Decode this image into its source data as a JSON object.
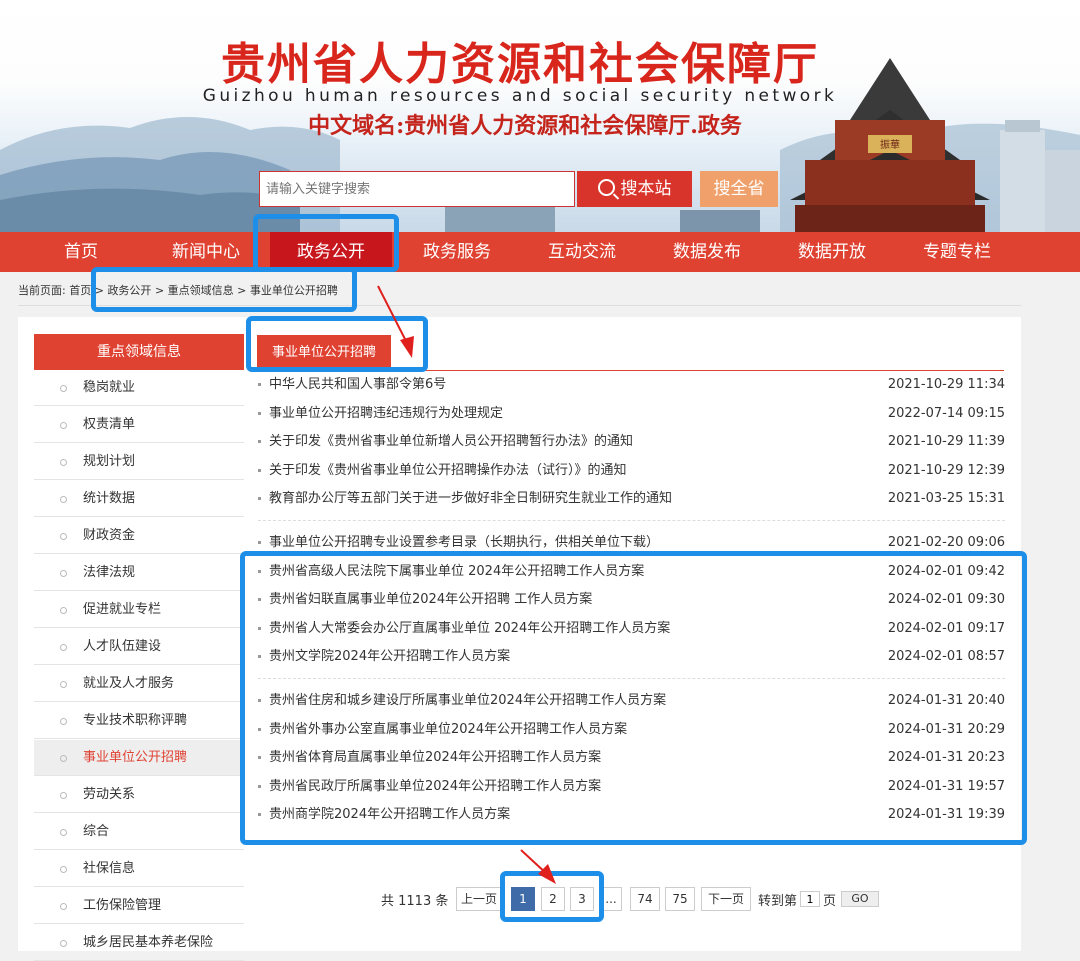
{
  "header": {
    "title": "贵州省人力资源和社会保障厅",
    "subtitle": "Guizhou human resources and social security network",
    "domain_name": "中文域名:贵州省人力资源和社会保障厅.政务",
    "tower_sign": "振華"
  },
  "search": {
    "placeholder": "请输入关键字搜索",
    "search_site_label": "搜本站",
    "search_all_label": "搜全省"
  },
  "nav": {
    "items": [
      "首页",
      "新闻中心",
      "政务公开",
      "政务服务",
      "互动交流",
      "数据发布",
      "数据开放",
      "专题专栏"
    ],
    "active_index": 2
  },
  "breadcrumb": {
    "prefix": "当前页面:",
    "items": [
      "首页",
      "政务公开",
      "重点领域信息",
      "事业单位公开招聘"
    ],
    "separator": ">"
  },
  "sidebar": {
    "heading": "重点领域信息",
    "items": [
      "稳岗就业",
      "权责清单",
      "规划计划",
      "统计数据",
      "财政资金",
      "法律法规",
      "促进就业专栏",
      "人才队伍建设",
      "就业及人才服务",
      "专业技术职称评聘",
      "事业单位公开招聘",
      "劳动关系",
      "综合",
      "社保信息",
      "工伤保险管理",
      "城乡居民基本养老保险"
    ],
    "active_index": 10
  },
  "content": {
    "tab_label": "事业单位公开招聘",
    "groups": [
      [
        {
          "title": "中华人民共和国人事部令第6号",
          "date": "2021-10-29 11:34"
        },
        {
          "title": "事业单位公开招聘违纪违规行为处理规定",
          "date": "2022-07-14 09:15"
        },
        {
          "title": "关于印发《贵州省事业单位新增人员公开招聘暂行办法》的通知",
          "date": "2021-10-29 11:39"
        },
        {
          "title": "关于印发《贵州省事业单位公开招聘操作办法（试行）》的通知",
          "date": "2021-10-29 12:39"
        },
        {
          "title": "教育部办公厅等五部门关于进一步做好非全日制研究生就业工作的通知",
          "date": "2021-03-25 15:31"
        }
      ],
      [
        {
          "title": "事业单位公开招聘专业设置参考目录（长期执行，供相关单位下载）",
          "date": "2021-02-20 09:06"
        },
        {
          "title": "贵州省高级人民法院下属事业单位 2024年公开招聘工作人员方案",
          "date": "2024-02-01 09:42"
        },
        {
          "title": "贵州省妇联直属事业单位2024年公开招聘 工作人员方案",
          "date": "2024-02-01 09:30"
        },
        {
          "title": "贵州省人大常委会办公厅直属事业单位 2024年公开招聘工作人员方案",
          "date": "2024-02-01 09:17"
        },
        {
          "title": "贵州文学院2024年公开招聘工作人员方案",
          "date": "2024-02-01 08:57"
        }
      ],
      [
        {
          "title": "贵州省住房和城乡建设厅所属事业单位2024年公开招聘工作人员方案",
          "date": "2024-01-31 20:40"
        },
        {
          "title": "贵州省外事办公室直属事业单位2024年公开招聘工作人员方案",
          "date": "2024-01-31 20:29"
        },
        {
          "title": "贵州省体育局直属事业单位2024年公开招聘工作人员方案",
          "date": "2024-01-31 20:23"
        },
        {
          "title": "贵州省民政厅所属事业单位2024年公开招聘工作人员方案",
          "date": "2024-01-31 19:57"
        },
        {
          "title": "贵州商学院2024年公开招聘工作人员方案",
          "date": "2024-01-31 19:39"
        }
      ]
    ]
  },
  "pagination": {
    "total_text": "共 1113 条",
    "prev_label": "上一页",
    "next_label": "下一页",
    "pages": [
      "1",
      "2",
      "3",
      "...",
      "74",
      "75"
    ],
    "current": "1",
    "jump_prefix": "转到第",
    "jump_value": "1",
    "jump_suffix": "页",
    "go_label": "GO"
  },
  "colors": {
    "nav_red": "#e04232",
    "nav_active": "#c8161d",
    "highlight_blue": "#1e8fe8",
    "arrow_red": "#e0201c",
    "page_current": "#3f6ca8"
  }
}
